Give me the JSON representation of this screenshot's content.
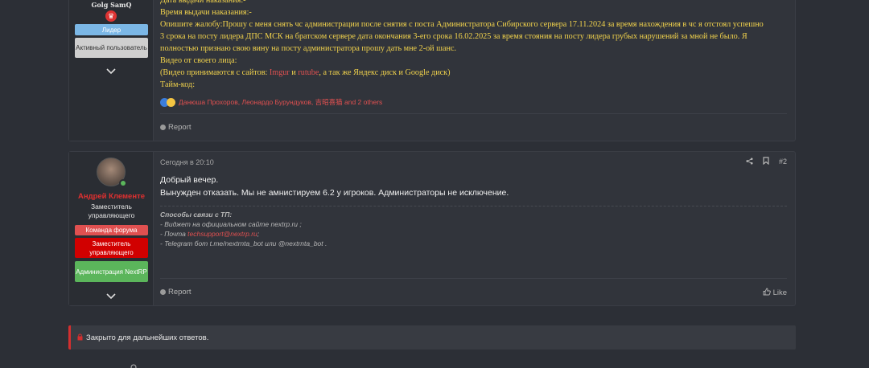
{
  "post1": {
    "username": "Golg SamQ",
    "badges": [
      {
        "label": "Лидер",
        "color": "#7bb7e6"
      },
      {
        "label": "Активный пользователь",
        "color": "#cfcfcf"
      }
    ],
    "lines": [
      "Дата выдачи наказания:-",
      "Время выдачи наказания:-",
      "Опишите жалобу:Прошу с меня снять чс администрации после снятия с поста Администратора Сибирского сервера 17.11.2024 за время нахождения в чс я отстоял успешно",
      "3 срока на посту лидера ДПС МСК на братском сервере дата окончания 3-его срока 16.02.2025 за время стояния на посту лидера грубых нарушений за мной не было. Я",
      "полностью признаю свою вину на посту администратора прошу дать мне 2-ой шанс.",
      "Видео от своего лица:"
    ],
    "video_line": {
      "prefix": "(Видео принимаются с сайтов: ",
      "imgur": "Imgur",
      "and": " и ",
      "rutube": "rutube",
      "suffix": ", а так же Яндекс диск и Google диск)"
    },
    "timecode": "Тайм-код:",
    "reactions_text": "Данюша Прохоров, Леонардо Бурундуков, 吉昭喜猫 and 2 others",
    "report_label": "Report"
  },
  "post2": {
    "username": "Андрей Клементе",
    "user_title": "Заместитель управляющего",
    "badges": [
      {
        "label": "Команда форума",
        "color": "#e05050"
      },
      {
        "label": "Заместитель управляющего",
        "color": "#d10000"
      },
      {
        "label": "Администрация NextRP",
        "color": "#5bb55b"
      }
    ],
    "date": "Сегодня в 20:10",
    "post_number": "#2",
    "message_lines": [
      "Добрый вечер.",
      "Вынужден отказать. Мы не амнистируем 6.2 у игроков. Администраторы не исключение."
    ],
    "signature": {
      "title": "Способы связи с ТП:",
      "line1": "- Виджет на официальном сайте nextrp.ru ;",
      "line2_prefix": "- Почта ",
      "line2_link": "techsupport@nextrp.ru",
      "line2_suffix": ";",
      "line3": "- Telegram бот t.me/nextrnta_bot или @nextrnta_bot ."
    },
    "report_label": "Report",
    "like_label": "Like"
  },
  "closed_notice": "Закрыто для дальнейших ответов."
}
